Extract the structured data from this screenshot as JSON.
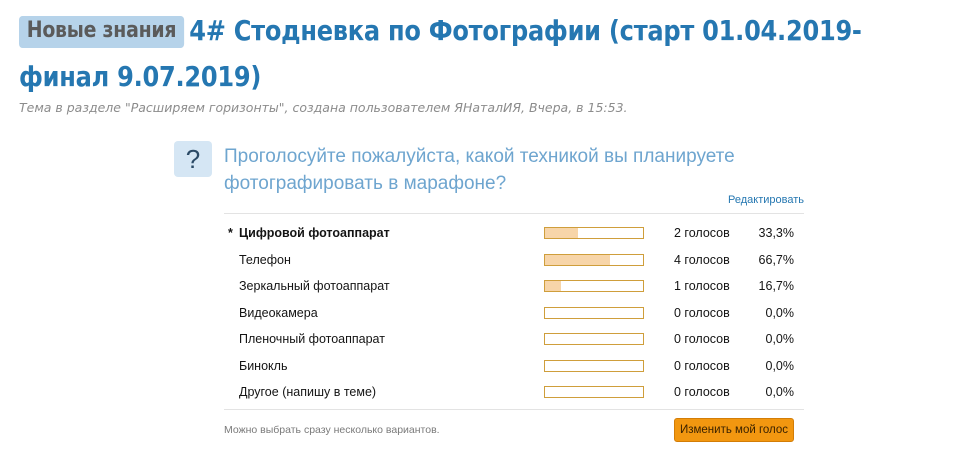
{
  "thread": {
    "prefix": "Новые знания",
    "title": "4# Стодневка по Фотографии (старт 01.04.2019- финал 9.07.2019)",
    "meta": "Тема в разделе \"Расширяем горизонты\", создана пользователем ЯНаталИЯ, Вчера, в 15:53."
  },
  "poll": {
    "icon": "?",
    "question": "Проголосуйте пожалуйста, какой техникой вы планируете фотографировать в марафоне?",
    "edit_label": "Редактировать",
    "options": [
      {
        "star": "*",
        "label": "Цифровой фотоаппарат",
        "votes": "2 голосов",
        "percent": "33,3%",
        "fraction": 0.333
      },
      {
        "star": "",
        "label": "Телефон",
        "votes": "4 голосов",
        "percent": "66,7%",
        "fraction": 0.667
      },
      {
        "star": "",
        "label": "Зеркальный фотоаппарат",
        "votes": "1 голосов",
        "percent": "16,7%",
        "fraction": 0.167
      },
      {
        "star": "",
        "label": "Видеокамера",
        "votes": "0 голосов",
        "percent": "0,0%",
        "fraction": 0
      },
      {
        "star": "",
        "label": "Пленочный фотоаппарат",
        "votes": "0 голосов",
        "percent": "0,0%",
        "fraction": 0
      },
      {
        "star": "",
        "label": "Бинокль",
        "votes": "0 голосов",
        "percent": "0,0%",
        "fraction": 0
      },
      {
        "star": "",
        "label": "Другое (напишу в теме)",
        "votes": "0 голосов",
        "percent": "0,0%",
        "fraction": 0
      }
    ],
    "note": "Можно выбрать сразу несколько вариантов.",
    "change_vote_label": "Изменить мой голос"
  },
  "colors": {
    "title": "#2577b1",
    "question": "#6ea5cf",
    "bar_fill": "#f7d5a9",
    "bar_border": "#cf9e3b",
    "button": "#f29710"
  }
}
